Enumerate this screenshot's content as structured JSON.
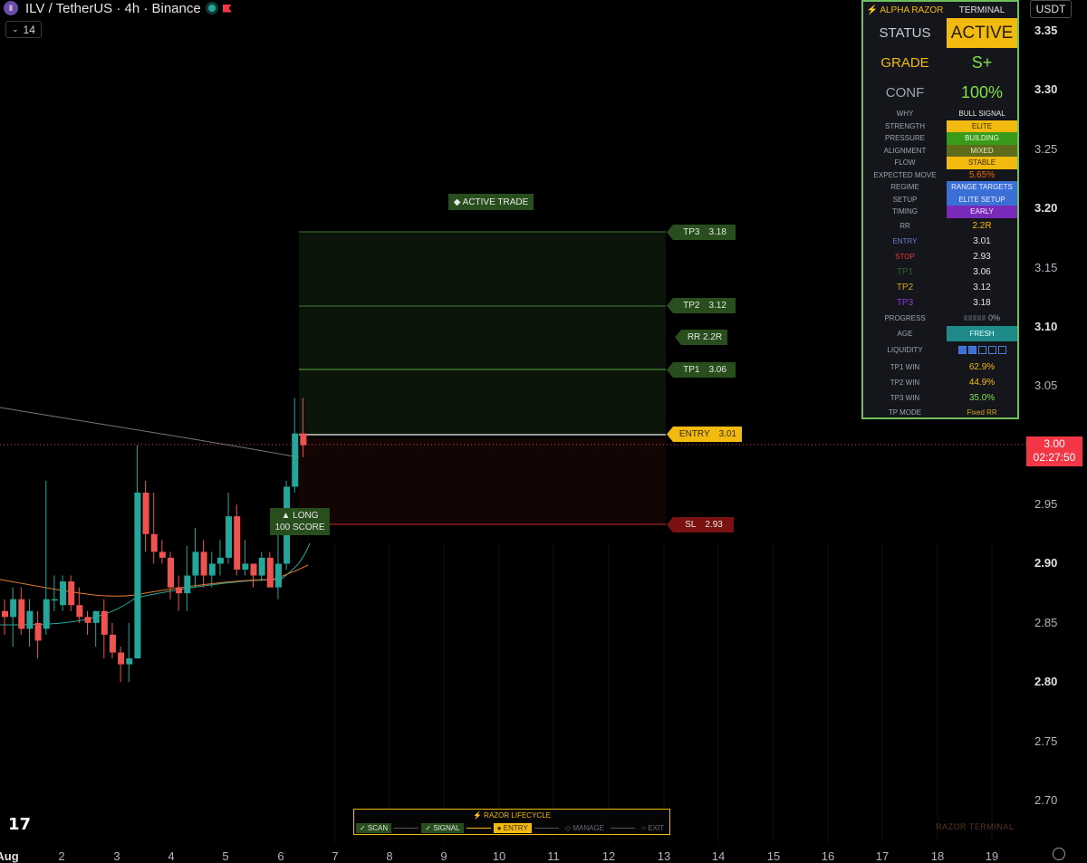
{
  "header": {
    "symbol_logo": "Ⅱ",
    "title": "ILV / TetherUS · 4h · Binance",
    "indicator_count": "14",
    "currency": "USDT"
  },
  "price_axis": {
    "labels": [
      "3.35",
      "3.30",
      "3.25",
      "3.20",
      "3.15",
      "3.10",
      "3.05",
      "2.95",
      "2.90",
      "2.85",
      "2.80",
      "2.75",
      "2.70"
    ],
    "current_price": "3.00",
    "countdown": "02:27:50"
  },
  "time_axis": {
    "labels": [
      "Aug",
      "2",
      "3",
      "4",
      "5",
      "6",
      "7",
      "8",
      "9",
      "10",
      "11",
      "12",
      "13",
      "14",
      "15",
      "16",
      "17",
      "18",
      "19"
    ]
  },
  "chart_data": {
    "type": "candlestick",
    "symbol": "ILVUSDT",
    "interval": "4h",
    "ylim": [
      2.67,
      3.37
    ],
    "candles": [
      {
        "o": 2.86,
        "h": 2.87,
        "l": 2.84,
        "c": 2.855
      },
      {
        "o": 2.855,
        "h": 2.88,
        "l": 2.83,
        "c": 2.87
      },
      {
        "o": 2.87,
        "h": 2.88,
        "l": 2.84,
        "c": 2.845
      },
      {
        "o": 2.845,
        "h": 2.87,
        "l": 2.83,
        "c": 2.86
      },
      {
        "o": 2.85,
        "h": 2.86,
        "l": 2.82,
        "c": 2.835
      },
      {
        "o": 2.845,
        "h": 2.97,
        "l": 2.84,
        "c": 2.87
      },
      {
        "o": 2.87,
        "h": 2.89,
        "l": 2.86,
        "c": 2.87
      },
      {
        "o": 2.865,
        "h": 2.89,
        "l": 2.86,
        "c": 2.885
      },
      {
        "o": 2.885,
        "h": 2.89,
        "l": 2.86,
        "c": 2.865
      },
      {
        "o": 2.865,
        "h": 2.88,
        "l": 2.85,
        "c": 2.855
      },
      {
        "o": 2.855,
        "h": 2.86,
        "l": 2.84,
        "c": 2.85
      },
      {
        "o": 2.85,
        "h": 2.86,
        "l": 2.83,
        "c": 2.86
      },
      {
        "o": 2.86,
        "h": 2.87,
        "l": 2.82,
        "c": 2.84
      },
      {
        "o": 2.84,
        "h": 2.85,
        "l": 2.82,
        "c": 2.825
      },
      {
        "o": 2.825,
        "h": 2.83,
        "l": 2.8,
        "c": 2.815
      },
      {
        "o": 2.815,
        "h": 2.85,
        "l": 2.8,
        "c": 2.82
      },
      {
        "o": 2.82,
        "h": 3.0,
        "l": 2.82,
        "c": 2.96
      },
      {
        "o": 2.96,
        "h": 2.97,
        "l": 2.91,
        "c": 2.925
      },
      {
        "o": 2.925,
        "h": 2.96,
        "l": 2.9,
        "c": 2.91
      },
      {
        "o": 2.91,
        "h": 2.92,
        "l": 2.9,
        "c": 2.905
      },
      {
        "o": 2.905,
        "h": 2.91,
        "l": 2.87,
        "c": 2.88
      },
      {
        "o": 2.88,
        "h": 2.89,
        "l": 2.86,
        "c": 2.875
      },
      {
        "o": 2.875,
        "h": 2.915,
        "l": 2.86,
        "c": 2.89
      },
      {
        "o": 2.89,
        "h": 2.93,
        "l": 2.88,
        "c": 2.91
      },
      {
        "o": 2.91,
        "h": 2.92,
        "l": 2.88,
        "c": 2.89
      },
      {
        "o": 2.89,
        "h": 2.91,
        "l": 2.88,
        "c": 2.9
      },
      {
        "o": 2.9,
        "h": 2.92,
        "l": 2.89,
        "c": 2.905
      },
      {
        "o": 2.905,
        "h": 2.96,
        "l": 2.9,
        "c": 2.94
      },
      {
        "o": 2.94,
        "h": 2.95,
        "l": 2.89,
        "c": 2.895
      },
      {
        "o": 2.895,
        "h": 2.92,
        "l": 2.89,
        "c": 2.9
      },
      {
        "o": 2.9,
        "h": 2.9,
        "l": 2.88,
        "c": 2.89
      },
      {
        "o": 2.89,
        "h": 2.91,
        "l": 2.885,
        "c": 2.905
      },
      {
        "o": 2.905,
        "h": 2.91,
        "l": 2.88,
        "c": 2.88
      },
      {
        "o": 2.88,
        "h": 2.93,
        "l": 2.87,
        "c": 2.9
      },
      {
        "o": 2.9,
        "h": 2.97,
        "l": 2.895,
        "c": 2.965
      },
      {
        "o": 2.965,
        "h": 3.04,
        "l": 2.96,
        "c": 3.01
      },
      {
        "o": 3.01,
        "h": 3.04,
        "l": 2.99,
        "c": 3.0
      }
    ],
    "levels": {
      "entry": 3.01,
      "stop": 2.93,
      "tp1": 3.06,
      "tp2": 3.12,
      "tp3": 3.18
    }
  },
  "trade_tags": {
    "tp3": {
      "label": "TP3",
      "value": "3.18"
    },
    "tp2": {
      "label": "TP2",
      "value": "3.12"
    },
    "rr": {
      "label": "RR 2.2R"
    },
    "tp1": {
      "label": "TP1",
      "value": "3.06"
    },
    "entry": {
      "label": "ENTRY",
      "value": "3.01"
    },
    "sl": {
      "label": "SL",
      "value": "2.93"
    }
  },
  "active_trade_label": "◆ ACTIVE TRADE",
  "long_badge": {
    "line1": "▲ LONG",
    "line2": "100 SCORE"
  },
  "terminal": {
    "header_left": "⚡ ALPHA RAZOR",
    "header_right": "TERMINAL",
    "status_label": "STATUS",
    "status_value": "ACTIVE",
    "grade_label": "GRADE",
    "grade_value": "S+",
    "conf_label": "CONF",
    "conf_value": "100%",
    "rows": [
      {
        "label": "WHY",
        "value": "BULL SIGNAL"
      },
      {
        "label": "STRENGTH",
        "value": "ELITE"
      },
      {
        "label": "PRESSURE",
        "value": "BUILDING"
      },
      {
        "label": "ALIGNMENT",
        "value": "MIXED"
      },
      {
        "label": "FLOW",
        "value": "STABLE"
      },
      {
        "label": "EXPECTED MOVE",
        "value": "5.65%"
      },
      {
        "label": "REGIME",
        "value": "RANGE TARGETS"
      },
      {
        "label": "SETUP",
        "value": "ELITE SETUP"
      },
      {
        "label": "TIMING",
        "value": "EARLY"
      }
    ],
    "rr_label": "RR",
    "rr_value": "2.2R",
    "entry_label": "ENTRY",
    "entry_value": "3.01",
    "stop_label": "STOP",
    "stop_value": "2.93",
    "tp1_label": "TP1",
    "tp1_value": "3.06",
    "tp2_label": "TP2",
    "tp2_value": "3.12",
    "tp3_label": "TP3",
    "tp3_value": "3.18",
    "progress_label": "PROGRESS",
    "progress_value": "0%",
    "age_label": "AGE",
    "age_value": "FRESH",
    "liquidity_label": "LIQUIDITY",
    "liquidity_filled": 2,
    "liquidity_total": 5,
    "tp1win_label": "TP1 WIN",
    "tp1win_value": "62.9%",
    "tp2win_label": "TP2 WIN",
    "tp2win_value": "44.9%",
    "tp3win_label": "TP3 WIN",
    "tp3win_value": "35.0%",
    "tpmode_label": "TP MODE",
    "tpmode_value": "Fixed RR"
  },
  "lifecycle": {
    "title": "⚡ RAZOR LIFECYCLE",
    "steps": [
      "✓ SCAN",
      "✓ SIGNAL",
      "● ENTRY",
      "◇ MANAGE",
      "○ EXIT"
    ]
  },
  "watermark": "RAZOR TERMINAL",
  "colors": {
    "up": "#26a69a",
    "down": "#ef5350",
    "accent": "#f2b90f",
    "tp": "#274e1c",
    "sl": "#7a1212"
  }
}
